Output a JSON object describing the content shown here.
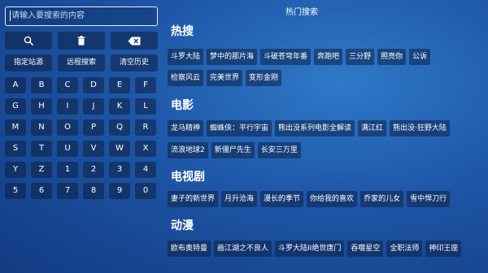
{
  "search": {
    "placeholder": "请输入要搜索的内容"
  },
  "tools": [
    {
      "icon": "search-icon"
    },
    {
      "icon": "trash-icon"
    },
    {
      "icon": "backspace-icon"
    }
  ],
  "functions": [
    "指定站源",
    "远程搜索",
    "清空历史"
  ],
  "keys": [
    "A",
    "B",
    "C",
    "D",
    "E",
    "F",
    "G",
    "H",
    "I",
    "J",
    "K",
    "L",
    "M",
    "N",
    "O",
    "P",
    "Q",
    "R",
    "S",
    "T",
    "U",
    "V",
    "W",
    "X",
    "Y",
    "Z",
    "1",
    "2",
    "3",
    "4",
    "5",
    "6",
    "7",
    "8",
    "9",
    "0"
  ],
  "hot_title": "热门搜索",
  "sections": [
    {
      "title": "热搜",
      "rows": [
        [
          "斗罗大陆",
          "梦中的那片海",
          "斗破苍穹年番",
          "奔跑吧",
          "三分野",
          "照亮你",
          "公诉"
        ],
        [
          "检察风云",
          "完美世界",
          "变形金刚"
        ]
      ]
    },
    {
      "title": "电影",
      "rows": [
        [
          "龙马精神",
          "蜘蛛侠：平行宇宙",
          "熊出没系列电影全解读",
          "满江红",
          "熊出没·狂野大陆"
        ],
        [
          "流浪地球2",
          "新僵尸先生",
          "长安三万里"
        ]
      ]
    },
    {
      "title": "电视剧",
      "rows": [
        [
          "妻子的新世界",
          "月升沧海",
          "漫长的季节",
          "你给我的喜欢",
          "乔家的儿女",
          "雪中悍刀行"
        ]
      ]
    },
    {
      "title": "动漫",
      "rows": [
        [
          "欧布奥特曼",
          "画江湖之不良人",
          "斗罗大陆II绝世唐门",
          "吞噬星空",
          "全职法师",
          "神印王座"
        ]
      ]
    }
  ]
}
